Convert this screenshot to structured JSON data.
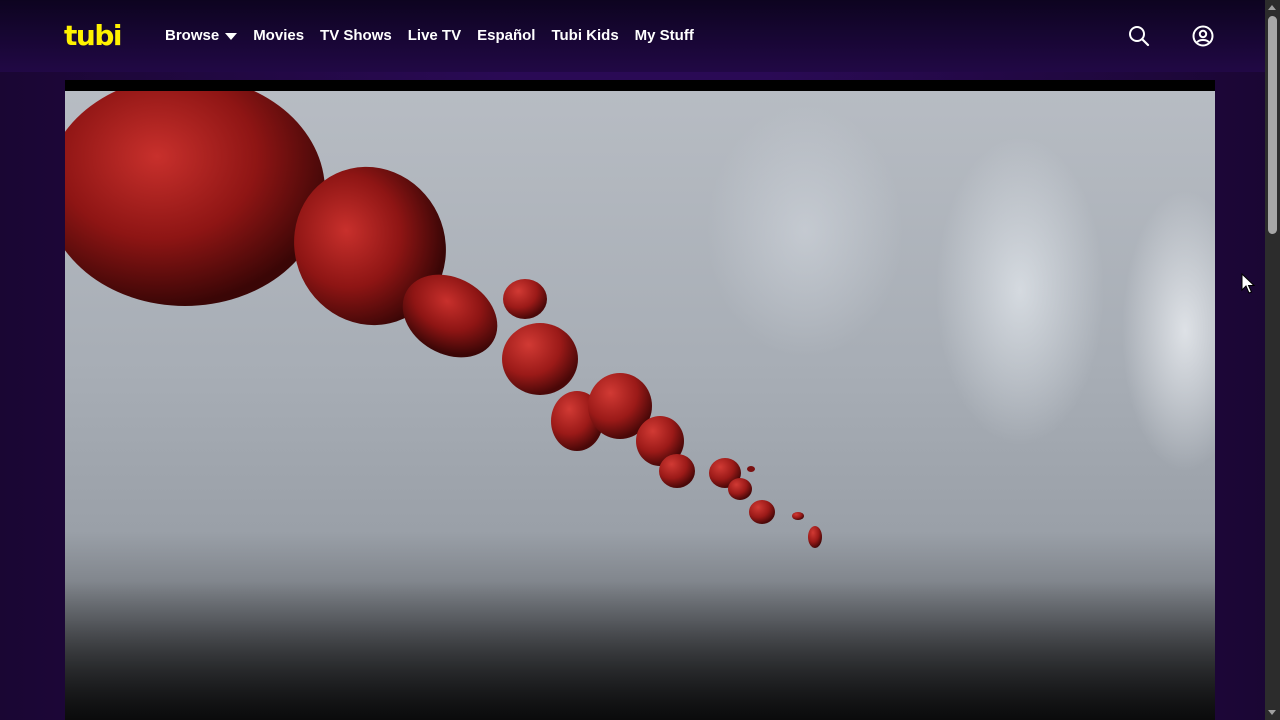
{
  "brand": {
    "logo_text": "tubi",
    "logo_color": "#fff200"
  },
  "nav": {
    "browse": "Browse",
    "movies": "Movies",
    "tv_shows": "TV Shows",
    "live_tv": "Live TV",
    "espanol": "Español",
    "tubi_kids": "Tubi Kids",
    "my_stuff": "My Stuff"
  },
  "icons": {
    "search": "search-icon",
    "account": "account-icon",
    "browse_caret": "chevron-down-icon"
  },
  "colors": {
    "header_bg": "#1c0739",
    "accent": "#fff200",
    "text": "#ffffff"
  }
}
